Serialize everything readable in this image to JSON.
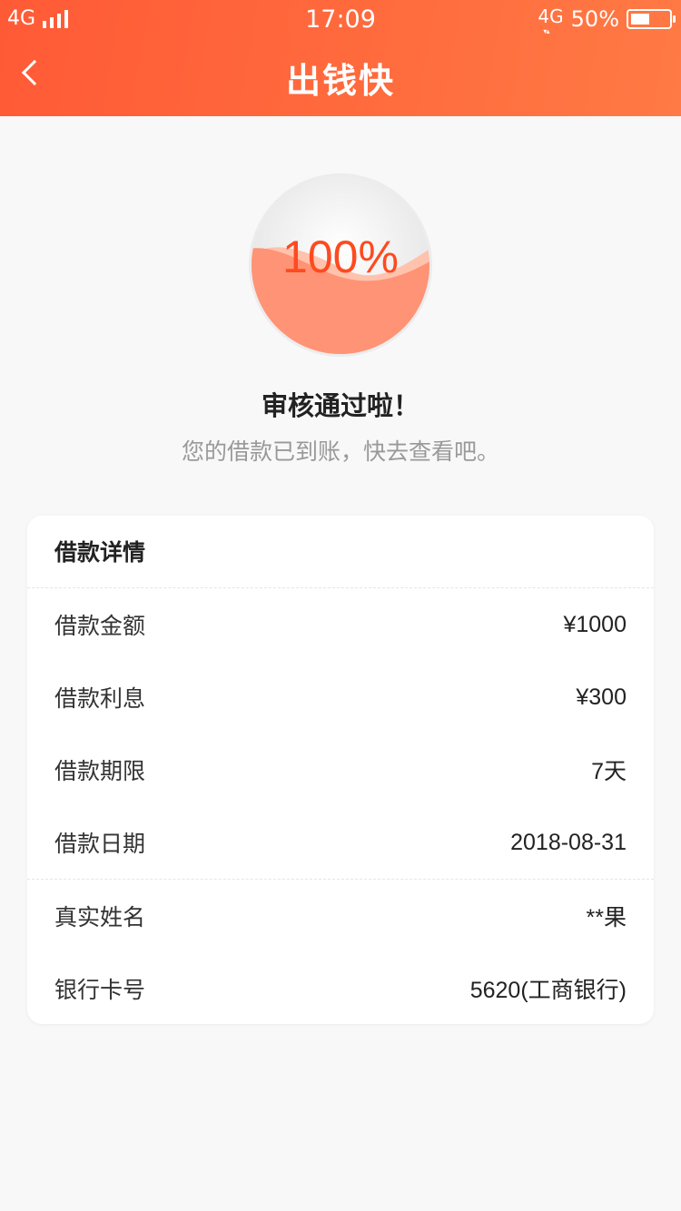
{
  "status_bar": {
    "network_left": "4G",
    "time": "17:09",
    "network_right": "4G",
    "battery_percent": "50%"
  },
  "header": {
    "back_icon": "chevron-left-icon",
    "title": "出钱快"
  },
  "progress": {
    "percent_text": "100%",
    "fill_fraction": 1.0,
    "fill_color": "#ff9375"
  },
  "result": {
    "title": "审核通过啦！",
    "subtitle": "您的借款已到账，快去查看吧。"
  },
  "details": {
    "header": "借款详情",
    "rows_primary": [
      {
        "label": "借款金额",
        "value": "¥1000"
      },
      {
        "label": "借款利息",
        "value": "¥300"
      },
      {
        "label": "借款期限",
        "value": "7天"
      },
      {
        "label": "借款日期",
        "value": "2018-08-31"
      }
    ],
    "rows_secondary": [
      {
        "label": "真实姓名",
        "value": "**果"
      },
      {
        "label": "银行卡号",
        "value": "5620(工商银行)"
      }
    ]
  },
  "colors": {
    "brand": "#ff5a36",
    "accent_text": "#ff4a1f"
  }
}
